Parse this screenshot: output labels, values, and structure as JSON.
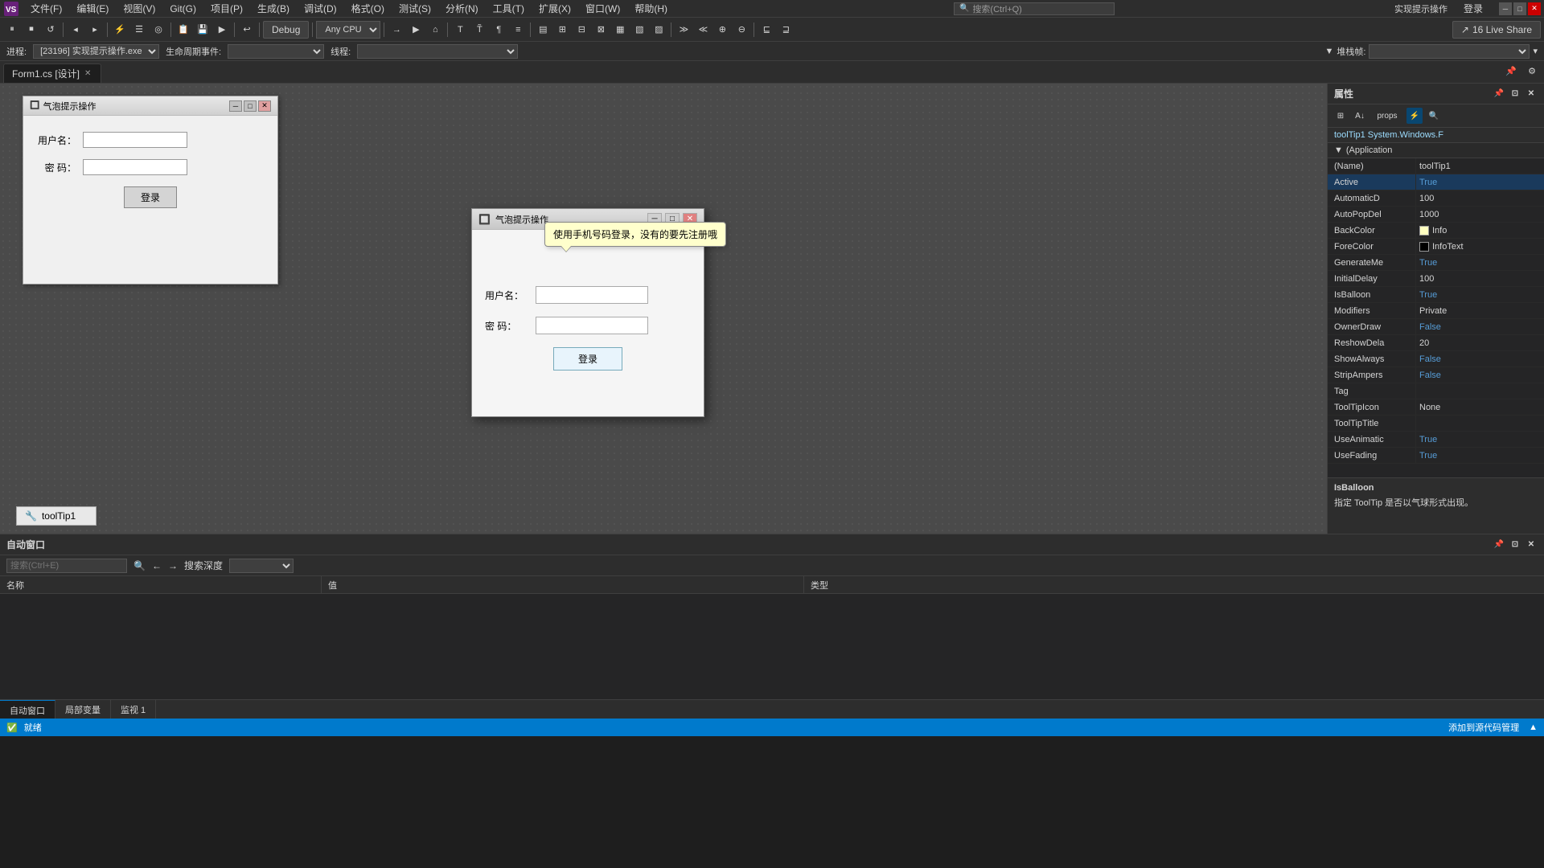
{
  "menu": {
    "logo": "VS",
    "items": [
      {
        "label": "文件(F)"
      },
      {
        "label": "编辑(E)"
      },
      {
        "label": "视图(V)"
      },
      {
        "label": "Git(G)"
      },
      {
        "label": "项目(P)"
      },
      {
        "label": "生成(B)"
      },
      {
        "label": "调试(D)"
      },
      {
        "label": "格式(O)"
      },
      {
        "label": "测试(S)"
      },
      {
        "label": "分析(N)"
      },
      {
        "label": "工具(T)"
      },
      {
        "label": "扩展(X)"
      },
      {
        "label": "窗口(W)"
      },
      {
        "label": "帮助(H)"
      }
    ],
    "search_placeholder": "搜索(Ctrl+Q)",
    "title": "实现提示操作",
    "signin": "登录"
  },
  "toolbar": {
    "debug_mode": "Debug",
    "cpu": "Any CPU",
    "live_share_label": "16 Live Share"
  },
  "process_bar": {
    "label_process": "进程:",
    "process_value": "[23196] 实现提示操作.exe",
    "label_lifecycle": "生命周期事件:",
    "label_thread": "线程:",
    "label_stack": "堆栈帧:"
  },
  "tab": {
    "label": "Form1.cs [设计]",
    "icons": "pin-icon"
  },
  "designer": {
    "bg_color": "#4a4a4a"
  },
  "form_bg": {
    "title": "气泡提示操作",
    "username_label": "用户名：",
    "password_label": "密  码：",
    "login_btn": "登录"
  },
  "form_dialog": {
    "title": "气泡提示操作",
    "username_label": "用户名：",
    "password_label": "密  码：",
    "login_btn": "登录",
    "tooltip_text": "使用手机号码登录，没有的要先注册哦"
  },
  "properties_panel": {
    "header": "属性",
    "component": "toolTip1  System.Windows.F",
    "section_label": "(Application",
    "rows": [
      {
        "name": "(Name)",
        "value": "toolTip1",
        "color": "white"
      },
      {
        "name": "Active",
        "value": "True",
        "color": "blue"
      },
      {
        "name": "AutomaticD",
        "value": "100",
        "color": "white"
      },
      {
        "name": "AutoPopDel",
        "value": "1000",
        "color": "white"
      },
      {
        "name": "BackColor",
        "value": "Info",
        "color": "white",
        "swatch": "#ffffc0"
      },
      {
        "name": "ForeColor",
        "value": "InfoText",
        "color": "white",
        "swatch": "#000000"
      },
      {
        "name": "GenerateMe",
        "value": "True",
        "color": "blue"
      },
      {
        "name": "InitialDelay",
        "value": "100",
        "color": "white"
      },
      {
        "name": "IsBalloon",
        "value": "True",
        "color": "blue"
      },
      {
        "name": "Modifiers",
        "value": "Private",
        "color": "white"
      },
      {
        "name": "OwnerDraw",
        "value": "False",
        "color": "blue"
      },
      {
        "name": "ReshowDela",
        "value": "20",
        "color": "white"
      },
      {
        "name": "ShowAlways",
        "value": "False",
        "color": "blue"
      },
      {
        "name": "StripAmpers",
        "value": "False",
        "color": "blue"
      },
      {
        "name": "Tag",
        "value": "",
        "color": "white"
      },
      {
        "name": "ToolTipIcon",
        "value": "None",
        "color": "white"
      },
      {
        "name": "ToolTipTitle",
        "value": "",
        "color": "white"
      },
      {
        "name": "UseAnimatic",
        "value": "True",
        "color": "blue"
      },
      {
        "name": "UseFading",
        "value": "True",
        "color": "blue"
      }
    ],
    "description_title": "IsBalloon",
    "description_text": "指定 ToolTip 是否以气球形式出现。"
  },
  "bottom_panel": {
    "title": "自动窗口",
    "search_placeholder": "搜索(Ctrl+E)",
    "depth_label": "搜索深度",
    "col_name": "名称",
    "col_value": "值",
    "col_type": "类型",
    "tabs": [
      {
        "label": "自动窗口",
        "active": true
      },
      {
        "label": "局部变量",
        "active": false
      },
      {
        "label": "监视 1",
        "active": false
      }
    ]
  },
  "tooltip_component": {
    "icon": "🔧",
    "label": "toolTip1"
  },
  "status_bar": {
    "status": "就绪",
    "right": "添加到源代码管理"
  }
}
